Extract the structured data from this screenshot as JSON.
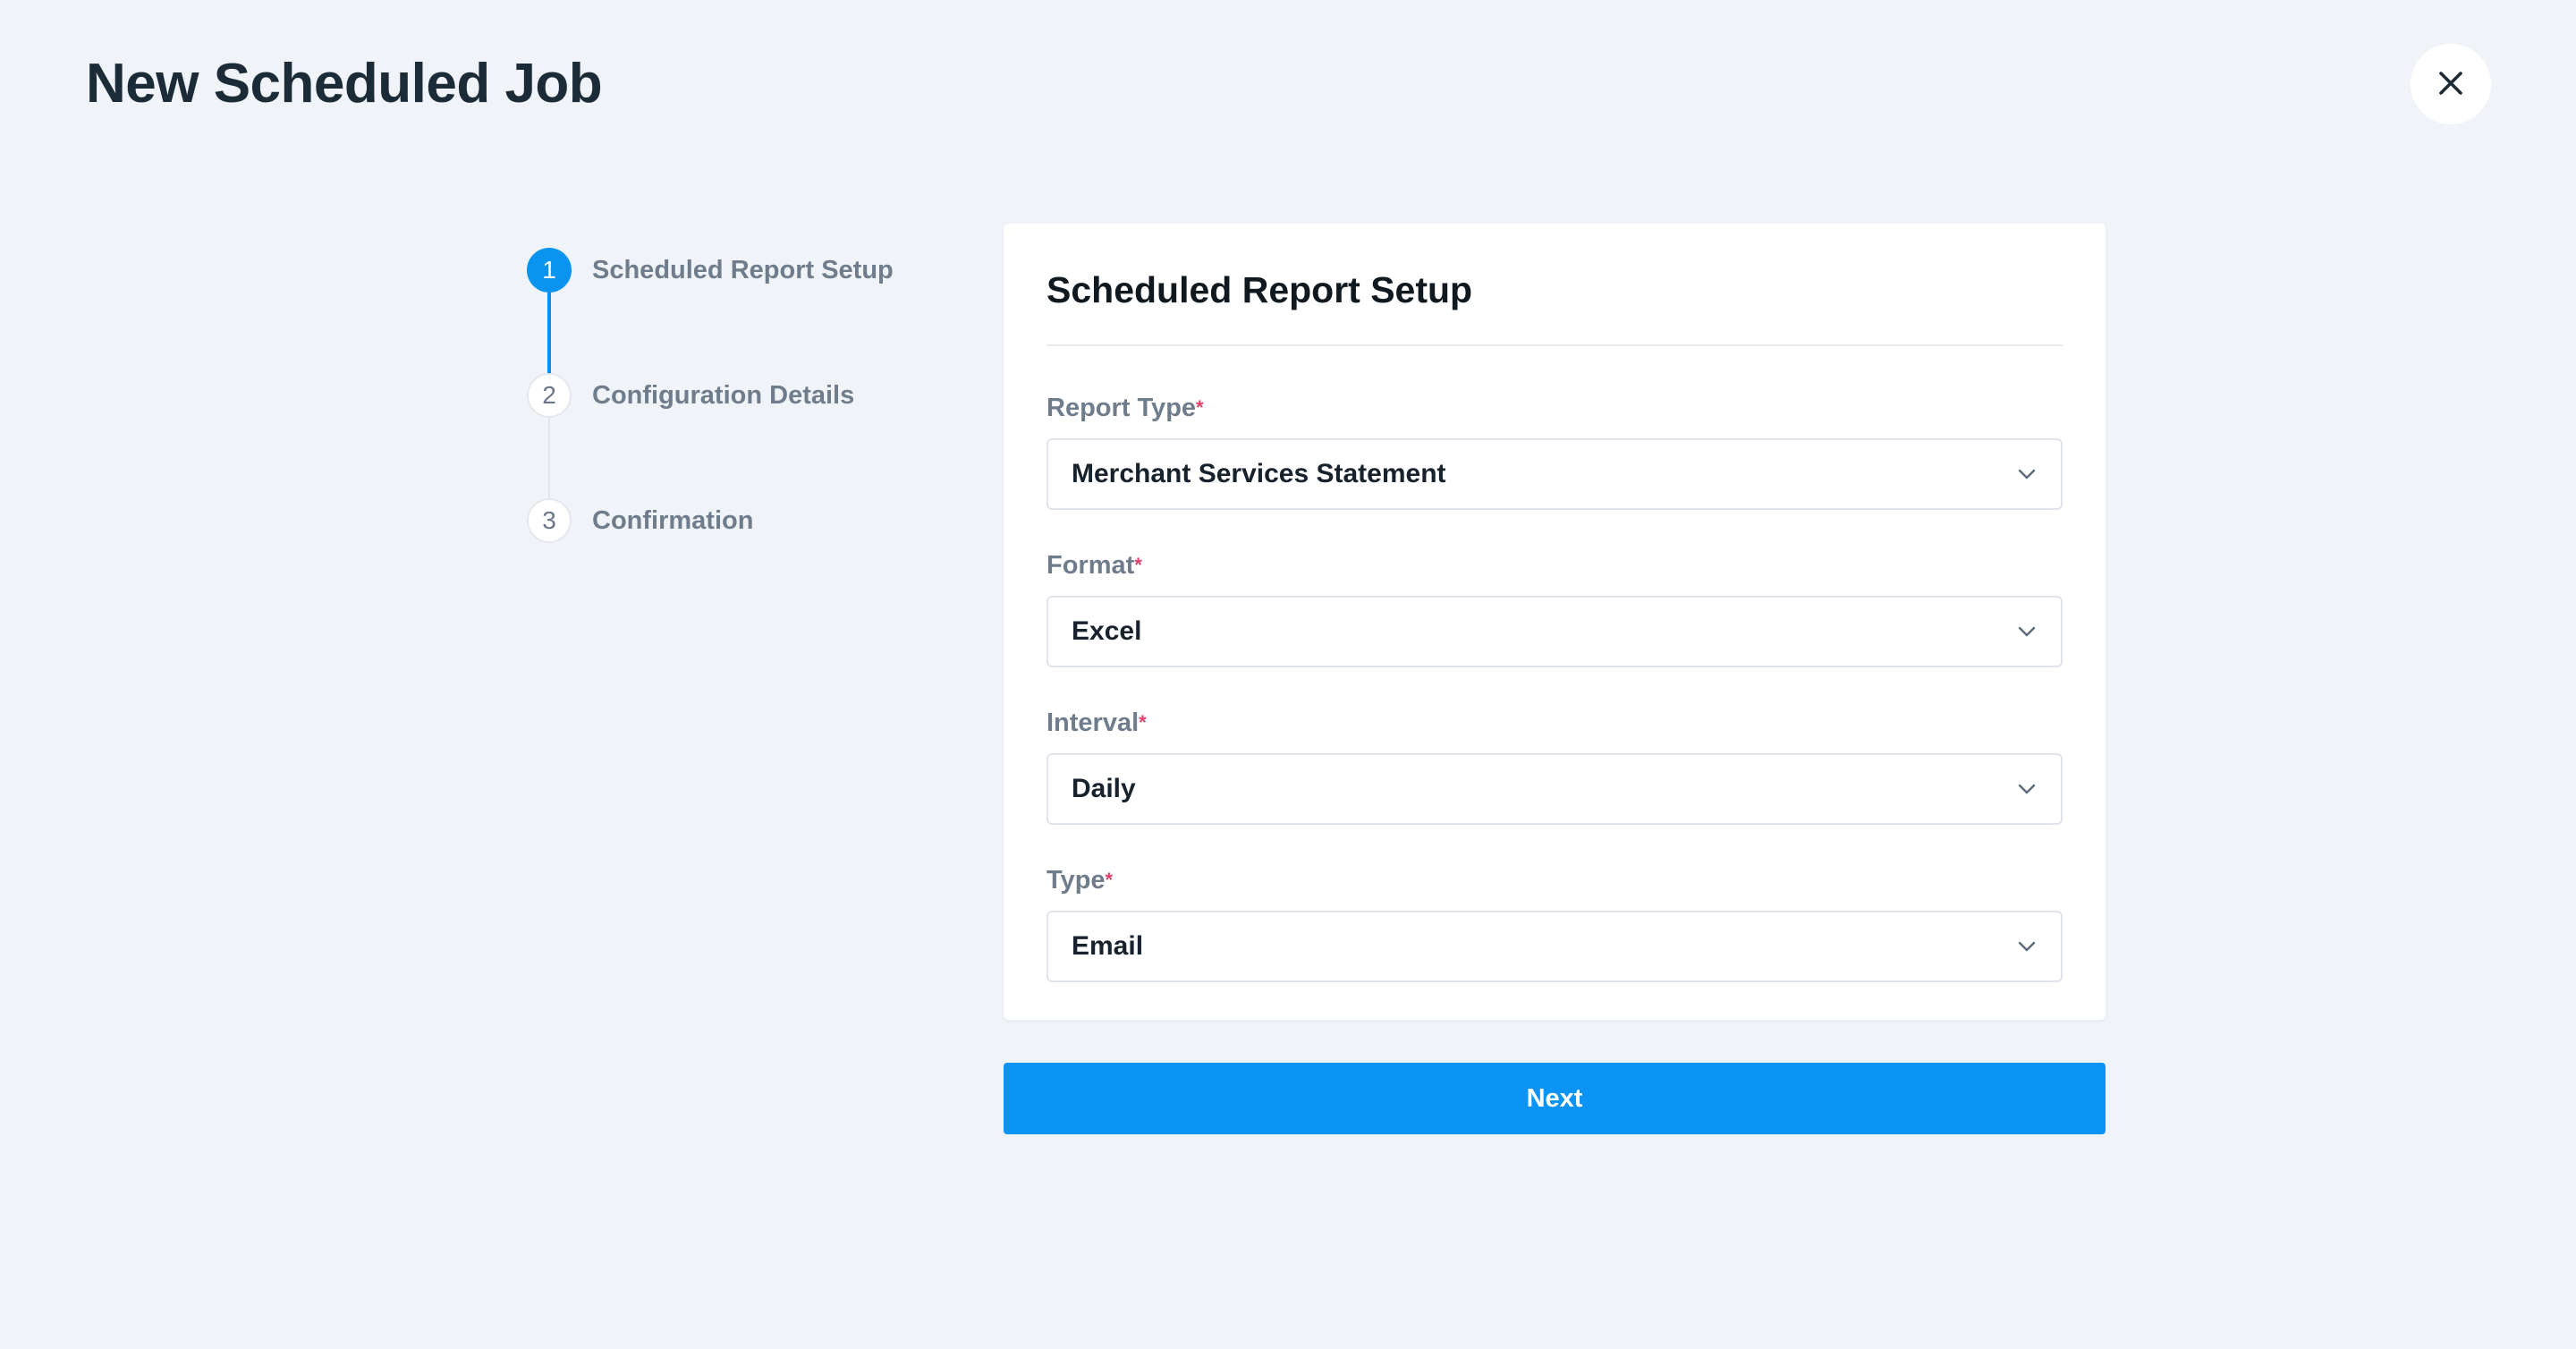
{
  "header": {
    "title": "New Scheduled Job"
  },
  "stepper": {
    "steps": [
      {
        "number": "1",
        "label": "Scheduled Report Setup",
        "state": "active"
      },
      {
        "number": "2",
        "label": "Configuration Details",
        "state": "pending"
      },
      {
        "number": "3",
        "label": "Confirmation",
        "state": "pending"
      }
    ]
  },
  "form": {
    "title": "Scheduled Report Setup",
    "fields": [
      {
        "label": "Report Type",
        "required_mark": "*",
        "value": "Merchant Services Statement"
      },
      {
        "label": "Format",
        "required_mark": "*",
        "value": "Excel"
      },
      {
        "label": "Interval",
        "required_mark": "*",
        "value": "Daily"
      },
      {
        "label": "Type",
        "required_mark": "*",
        "value": "Email"
      }
    ]
  },
  "actions": {
    "next_label": "Next"
  },
  "icons": {
    "close": "close-icon",
    "dropdown": "chevron-down-icon"
  },
  "colors": {
    "background": "#f0f3f8",
    "accent": "#0b93f5",
    "required": "#e0406a",
    "title_text": "#1b2b38"
  }
}
